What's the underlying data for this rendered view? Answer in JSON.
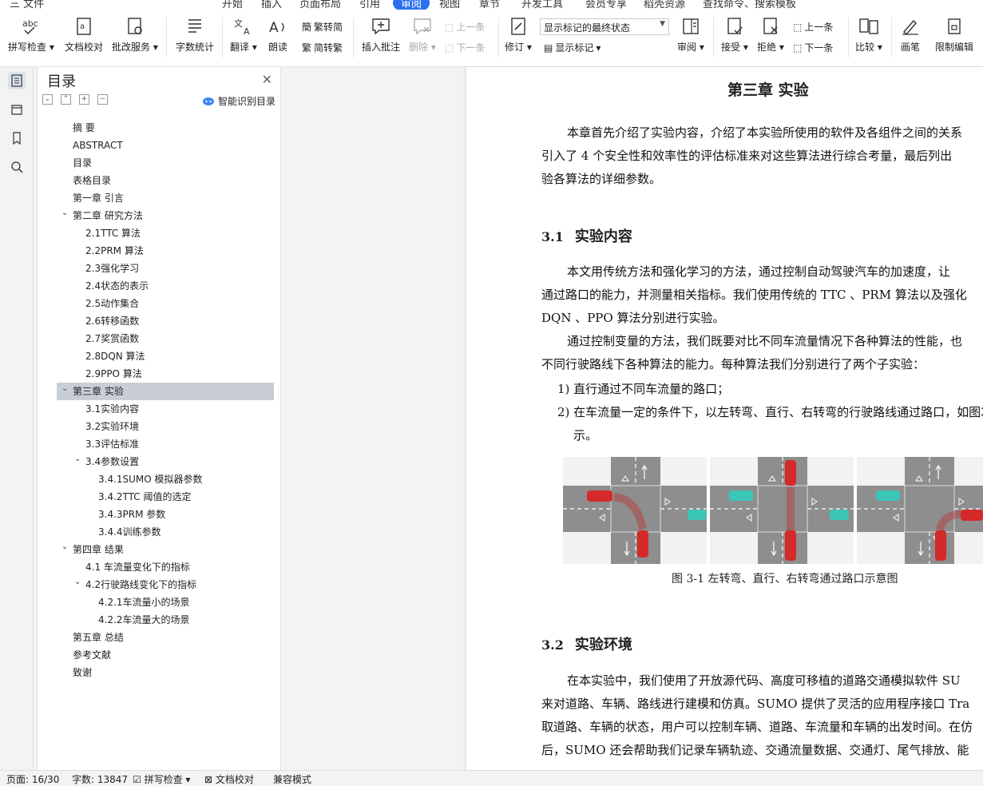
{
  "menu": {
    "items": [
      "三 文件",
      "开始",
      "插入",
      "页面布局",
      "引用",
      "审阅",
      "视图",
      "章节",
      "开发工具",
      "会员专享",
      "稻壳资源",
      "查找命令、搜索模板"
    ]
  },
  "ribbon": {
    "spell_check": "拼写检查",
    "proofread": "文档校对",
    "revise_service": "批改服务",
    "word_count": "字数统计",
    "translate": "翻译",
    "read_aloud": "朗读",
    "trad_to_simp": "繁转简",
    "simp_to_trad": "简转繁",
    "insert_comment": "插入批注",
    "delete": "删除",
    "prev_comment": "上一条",
    "next_comment": "下一条",
    "track_changes": "修订",
    "markup_select": "显示标记的最终状态",
    "show_markup": "显示标记",
    "review": "审阅",
    "accept": "接受",
    "reject": "拒绝",
    "prev_change": "上一条",
    "next_change": "下一条",
    "compare": "比较",
    "pen": "画笔",
    "restrict_edit": "限制编辑"
  },
  "toc": {
    "title": "目录",
    "smart_detect": "智能识别目录",
    "items": [
      {
        "label": "摘  要",
        "level": 1
      },
      {
        "label": "ABSTRACT",
        "level": 1
      },
      {
        "label": "目录",
        "level": 1
      },
      {
        "label": "表格目录",
        "level": 1
      },
      {
        "label": "第一章  引言",
        "level": 1
      },
      {
        "label": "第二章  研究方法",
        "level": 1,
        "expanded": true
      },
      {
        "label": "2.1TTC 算法",
        "level": 2
      },
      {
        "label": "2.2PRM 算法",
        "level": 2
      },
      {
        "label": "2.3强化学习",
        "level": 2
      },
      {
        "label": "2.4状态的表示",
        "level": 2
      },
      {
        "label": "2.5动作集合",
        "level": 2
      },
      {
        "label": "2.6转移函数",
        "level": 2
      },
      {
        "label": "2.7奖赏函数",
        "level": 2
      },
      {
        "label": "2.8DQN 算法",
        "level": 2
      },
      {
        "label": "2.9PPO 算法",
        "level": 2
      },
      {
        "label": "第三章  实验",
        "level": 1,
        "expanded": true,
        "selected": true
      },
      {
        "label": "3.1实验内容",
        "level": 2
      },
      {
        "label": "3.2实验环境",
        "level": 2
      },
      {
        "label": "3.3评估标准",
        "level": 2
      },
      {
        "label": "3.4参数设置",
        "level": 2,
        "expanded": true
      },
      {
        "label": "3.4.1SUMO 模拟器参数",
        "level": 3
      },
      {
        "label": "3.4.2TTC 阈值的选定",
        "level": 3
      },
      {
        "label": "3.4.3PRM 参数",
        "level": 3
      },
      {
        "label": "3.4.4训练参数",
        "level": 3
      },
      {
        "label": "第四章  结果",
        "level": 1,
        "expanded": true
      },
      {
        "label": "4.1  车流量变化下的指标",
        "level": 2
      },
      {
        "label": "4.2行驶路线变化下的指标",
        "level": 2,
        "expanded": true
      },
      {
        "label": "4.2.1车流量小的场景",
        "level": 3
      },
      {
        "label": "4.2.2车流量大的场景",
        "level": 3
      },
      {
        "label": "第五章  总结",
        "level": 1
      },
      {
        "label": "参考文献",
        "level": 1
      },
      {
        "label": "致谢",
        "level": 1
      }
    ]
  },
  "document": {
    "chapter_title": "第三章      实验",
    "intro_lines": [
      "本章首先介绍了实验内容，介绍了本实验所使用的软件及各组件之间的关系",
      "引入了  4 个安全性和效率性的评估标准来对这些算法进行综合考量，最后列出",
      "验各算法的详细参数。"
    ],
    "sec1_num": "3.1",
    "sec1_title": "实验内容",
    "sec1_lines": [
      "本文用传统方法和强化学习的方法，通过控制自动驾驶汽车的加速度，让",
      "通过路口的能力，并测量相关指标。我们使用传统的  TTC 、PRM 算法以及强化",
      "DQN 、PPO 算法分别进行实验。",
      "通过控制变量的方法，我们既要对比不同车流量情况下各种算法的性能，也",
      "不同行驶路线下各种算法的能力。每种算法我们分别进行了两个子实验："
    ],
    "list1": "1)  直行通过不同车流量的路口；",
    "list2": "2)  在车流量一定的条件下，以左转弯、直行、右转弯的行驶路线通过路口，如图3",
    "list2_cont": "示。",
    "figure_caption": "图 3-1 左转弯、直行、右转弯通过路口示意图",
    "sec2_num": "3.2",
    "sec2_title": "实验环境",
    "sec2_lines": [
      "在本实验中，我们使用了开放源代码、高度可移植的道路交通模拟软件  SU",
      "来对道路、车辆、路线进行建模和仿真。SUMO 提供了灵活的应用程序接口  Tra",
      "取道路、车辆的状态，用户可以控制车辆、道路、车流量和车辆的出发时间。在仿",
      "后，SUMO 还会帮助我们记录车辆轨迹、交通流量数据、交通灯、尾气排放、能"
    ]
  },
  "status": {
    "page": "页面: 16/30",
    "words": "字数: 13847",
    "spell": "拼写检查",
    "proof": "文档校对",
    "compat": "兼容模式"
  }
}
